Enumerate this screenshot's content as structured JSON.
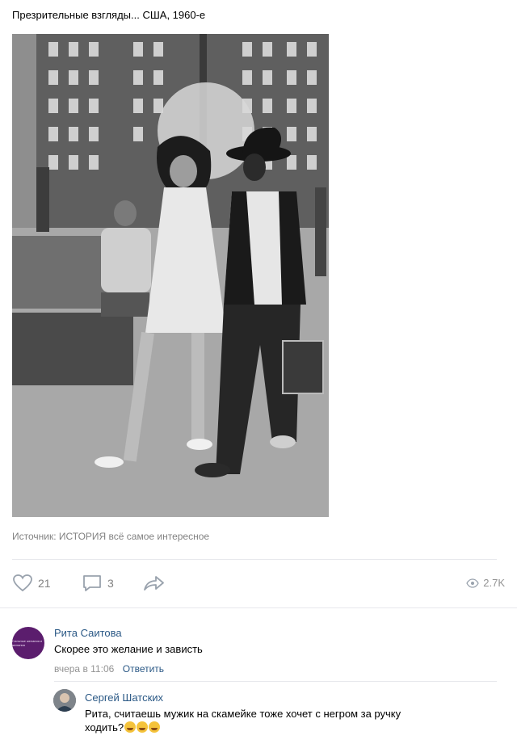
{
  "post": {
    "text": "Презрительные взгляды... США, 1960-е",
    "source": "Источник: ИСТОРИЯ всё самое интересное"
  },
  "actions": {
    "likes": "21",
    "comments": "3",
    "views": "2.7K",
    "icons": [
      "heart-icon",
      "comment-icon",
      "share-icon",
      "eye-icon"
    ]
  },
  "comments": [
    {
      "author": "Рита Саитова",
      "text": "Скорее это желание и зависть",
      "time": "вчера в 11:06",
      "reply_label": "Ответить",
      "avatar_text": "Сильные желания и желания"
    },
    {
      "author": "Сергей Шатских",
      "text_line1": "Рита, считаешь мужик на скамейке тоже хочет с негром за ручку",
      "text_line2": "ходить?",
      "emoji": "😂😂😂"
    }
  ],
  "colors": {
    "link": "#2a5885",
    "muted": "#828282",
    "divider": "#e7e8ec",
    "avatar_bg": "#5b1d6d"
  }
}
